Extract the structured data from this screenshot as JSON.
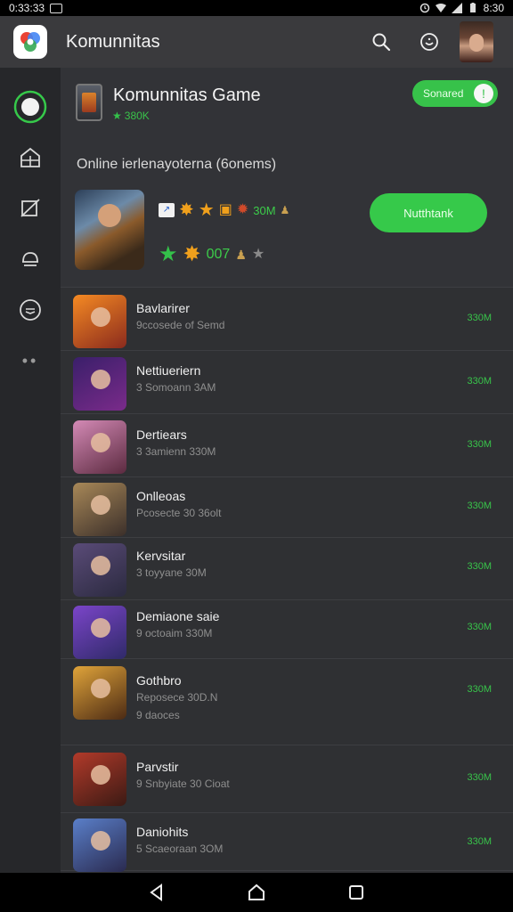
{
  "status_bar": {
    "time": "0:33:33",
    "right_time": "8:30",
    "icons": [
      "image-icon",
      "alarm-icon",
      "wifi-icon",
      "signal-icon",
      "battery-icon"
    ]
  },
  "app_bar": {
    "title": "Komunnitas",
    "actions": [
      "search-icon",
      "emoji-icon"
    ]
  },
  "side_rail": {
    "items": [
      "home-icon",
      "store-icon",
      "tag-icon",
      "cloud-icon",
      "chat-icon"
    ],
    "more": "••"
  },
  "header": {
    "title": "Komunnitas Game",
    "rating": "380K",
    "toggle_label": "Sonared",
    "subtitle": "Online ierlenayoterna (6onems)",
    "rating_row_1_text": "30M",
    "rating_row_2_text": "007",
    "action_button": "Nutthtank"
  },
  "games": [
    {
      "name": "Bavlarirer",
      "sub1": "9ccosede of Semd",
      "sub2": "",
      "size": "330M",
      "colors": [
        "#f58a23",
        "#8a2a1d"
      ]
    },
    {
      "name": "Nettiueriern",
      "sub1": "3 Somoann 3AM",
      "sub2": "",
      "size": "330M",
      "colors": [
        "#3a1f6a",
        "#7a2b8a"
      ]
    },
    {
      "name": "Dertiears",
      "sub1": "3 3amienn 330M",
      "sub2": "",
      "size": "330M",
      "colors": [
        "#d48ab6",
        "#5b2a3f"
      ]
    },
    {
      "name": "Onlleoas",
      "sub1": "Pcosecte 30 36olt",
      "sub2": "",
      "size": "330M",
      "colors": [
        "#a88858",
        "#3b2f2a"
      ]
    },
    {
      "name": "Kervsitar",
      "sub1": "3 toyyane 30M",
      "sub2": "",
      "size": "330M",
      "colors": [
        "#5a4b78",
        "#2b2a3f"
      ]
    },
    {
      "name": "Demiaone saie",
      "sub1": "9 octoaim 330M",
      "sub2": "",
      "size": "330M",
      "colors": [
        "#7b45c9",
        "#2f2a68"
      ]
    },
    {
      "name": "Gothbro",
      "sub1": "Reposece 30D.N",
      "sub2": "9 daoces",
      "size": "330M",
      "colors": [
        "#e0a43a",
        "#4b2a14"
      ]
    },
    {
      "name": "Parvstir",
      "sub1": "9 Snbyiate 30 Cioat",
      "sub2": "",
      "size": "330M",
      "colors": [
        "#b23a2a",
        "#3b1a14"
      ]
    },
    {
      "name": "Daniohits",
      "sub1": "5 Scaeoraan 3OM",
      "sub2": "",
      "size": "330M",
      "colors": [
        "#5a7fc9",
        "#2a2a4f"
      ]
    }
  ],
  "nav_bar": [
    "back-icon",
    "home-nav-icon",
    "recents-icon"
  ]
}
